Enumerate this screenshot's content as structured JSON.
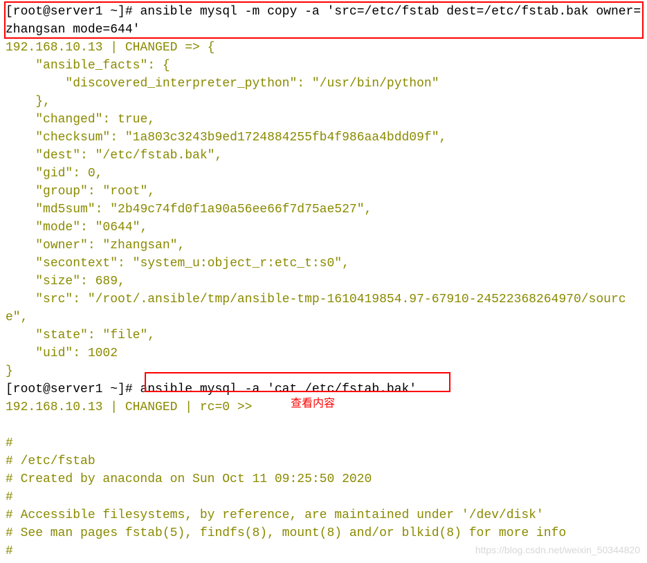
{
  "prompt1": {
    "prefix": "[root@server1 ~]# ",
    "command": "ansible mysql -m copy -a 'src=/etc/fstab dest=/etc/fstab.bak owner=zhangsan mode=644'"
  },
  "output1": {
    "host_line": "192.168.10.13 | CHANGED => {",
    "facts_open": "    \"ansible_facts\": {",
    "facts_interp": "        \"discovered_interpreter_python\": \"/usr/bin/python\"",
    "facts_close": "    },",
    "changed": "    \"changed\": true,",
    "checksum": "    \"checksum\": \"1a803c3243b9ed1724884255fb4f986aa4bdd09f\",",
    "dest": "    \"dest\": \"/etc/fstab.bak\",",
    "gid": "    \"gid\": 0,",
    "group": "    \"group\": \"root\",",
    "md5sum": "    \"md5sum\": \"2b49c74fd0f1a90a56ee66f7d75ae527\",",
    "mode": "    \"mode\": \"0644\",",
    "owner": "    \"owner\": \"zhangsan\",",
    "secontext": "    \"secontext\": \"system_u:object_r:etc_t:s0\",",
    "size": "    \"size\": 689,",
    "src": "    \"src\": \"/root/.ansible/tmp/ansible-tmp-1610419854.97-67910-24522368264970/source\",",
    "state": "    \"state\": \"file\",",
    "uid": "    \"uid\": 1002",
    "close": "}"
  },
  "prompt2": {
    "prefix": "[root@server1 ~]# ",
    "command": "ansible mysql -a 'cat /etc/fstab.bak'"
  },
  "output2": {
    "host_line": "192.168.10.13 | CHANGED | rc=0 >>",
    "blank": "",
    "l1": "#",
    "l2": "# /etc/fstab",
    "l3": "# Created by anaconda on Sun Oct 11 09:25:50 2020",
    "l4": "#",
    "l5": "# Accessible filesystems, by reference, are maintained under '/dev/disk'",
    "l6": "# See man pages fstab(5), findfs(8), mount(8) and/or blkid(8) for more info",
    "l7": "#"
  },
  "annotation": "查看内容",
  "watermark": "https://blog.csdn.net/weixin_50344820"
}
